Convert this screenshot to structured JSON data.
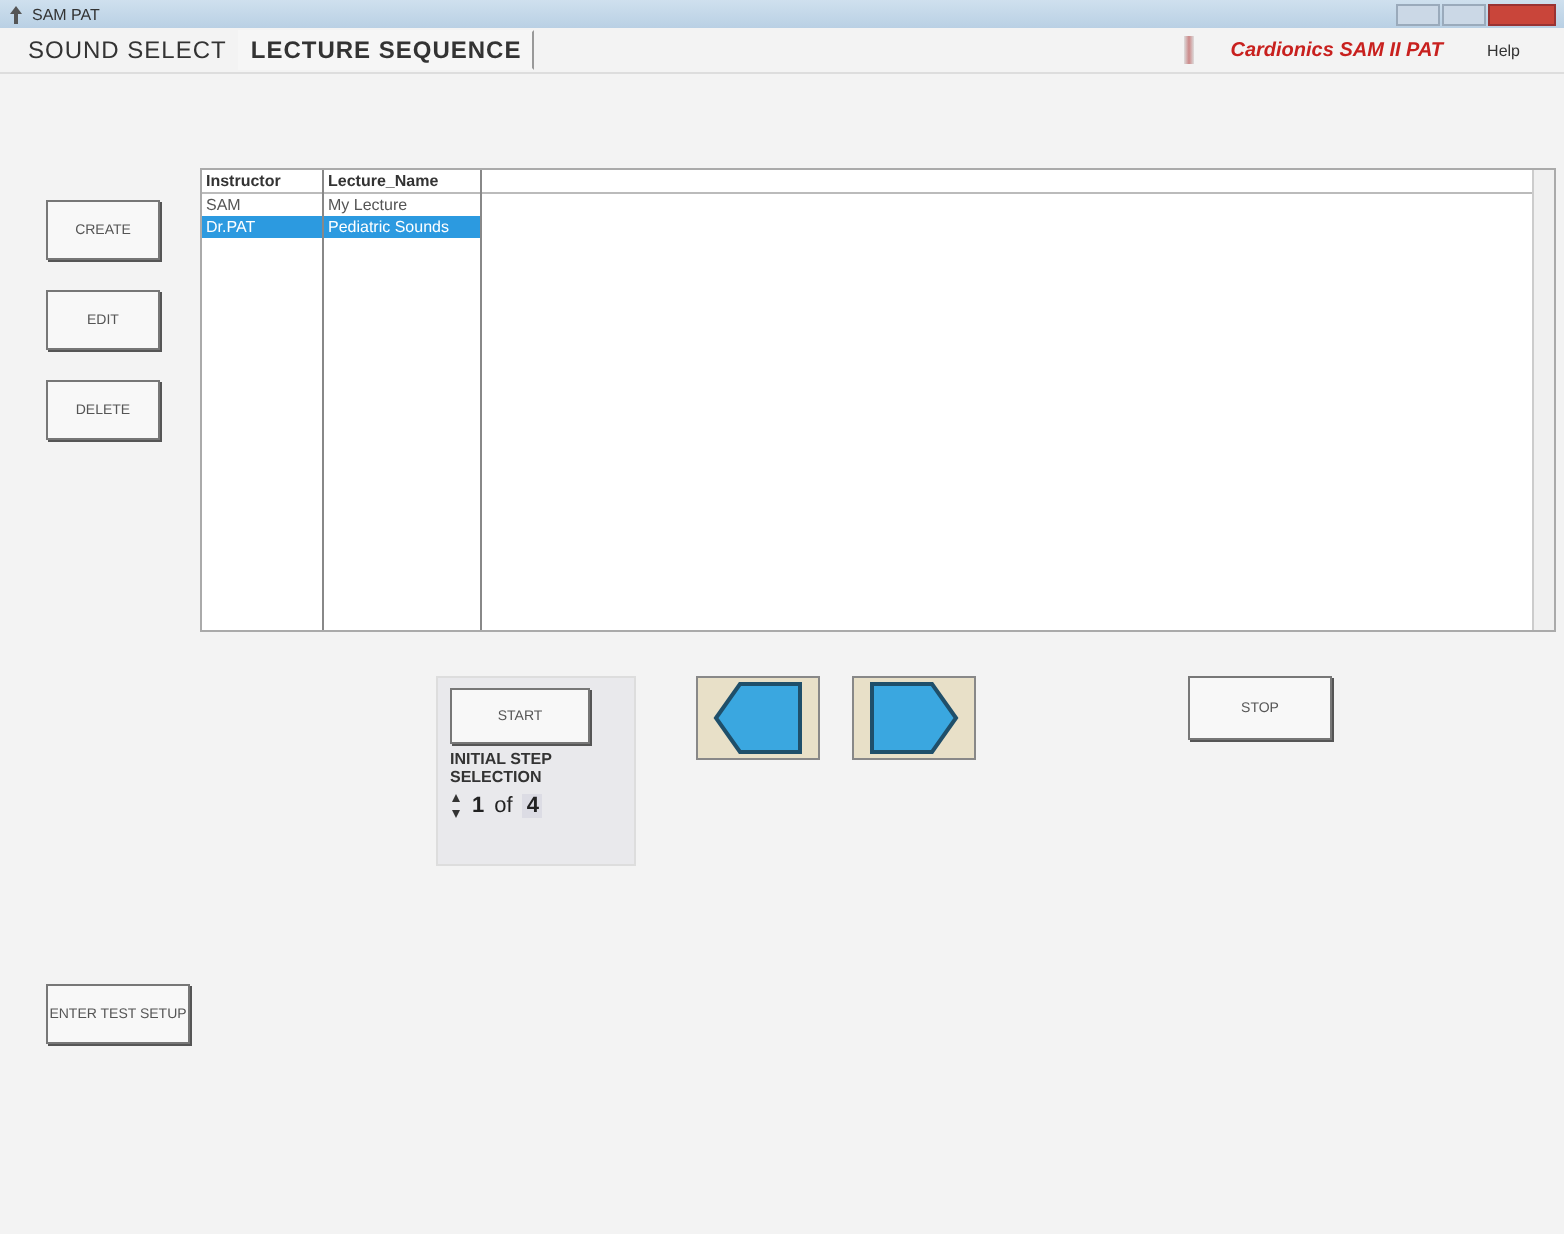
{
  "window": {
    "title": "SAM PAT"
  },
  "tabs": [
    {
      "label": "SOUND SELECT",
      "selected": false
    },
    {
      "label": "LECTURE SEQUENCE",
      "selected": true
    }
  ],
  "brand": "Cardionics SAM II PAT",
  "menu": [
    "Help"
  ],
  "side_buttons": [
    "CREATE",
    "EDIT",
    "DELETE"
  ],
  "setup_button": "ENTER TEST SETUP",
  "table": {
    "columns": [
      "Instructor",
      "Lecture_Name"
    ],
    "rows": [
      {
        "cells": [
          "SAM",
          "My Lecture"
        ],
        "selected": false
      },
      {
        "cells": [
          "Dr.PAT",
          "Pediatric Sounds"
        ],
        "selected": true
      }
    ]
  },
  "start_button": "START",
  "step": {
    "label": "INITIAL STEP SELECTION",
    "value": "1",
    "of": "of",
    "total": "4"
  },
  "stop_button": "STOP"
}
